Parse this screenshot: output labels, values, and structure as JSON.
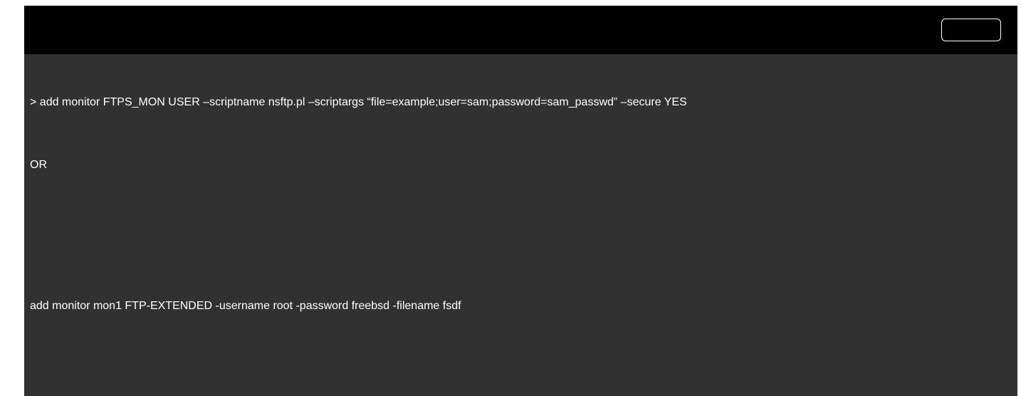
{
  "code_block": {
    "copy_button_label": "",
    "lines": [
      "> add monitor FTPS_MON USER –scriptname nsftp.pl –scriptargs “file=example;user=sam;password=sam_passwd” –secure YES",
      "OR",
      "add monitor mon1 FTP-EXTENDED -username root -password freebsd -filename fsdf"
    ]
  },
  "colors": {
    "header_background": "#000000",
    "code_background": "#313131",
    "text": "#ffffff",
    "page_background": "#ffffff"
  }
}
